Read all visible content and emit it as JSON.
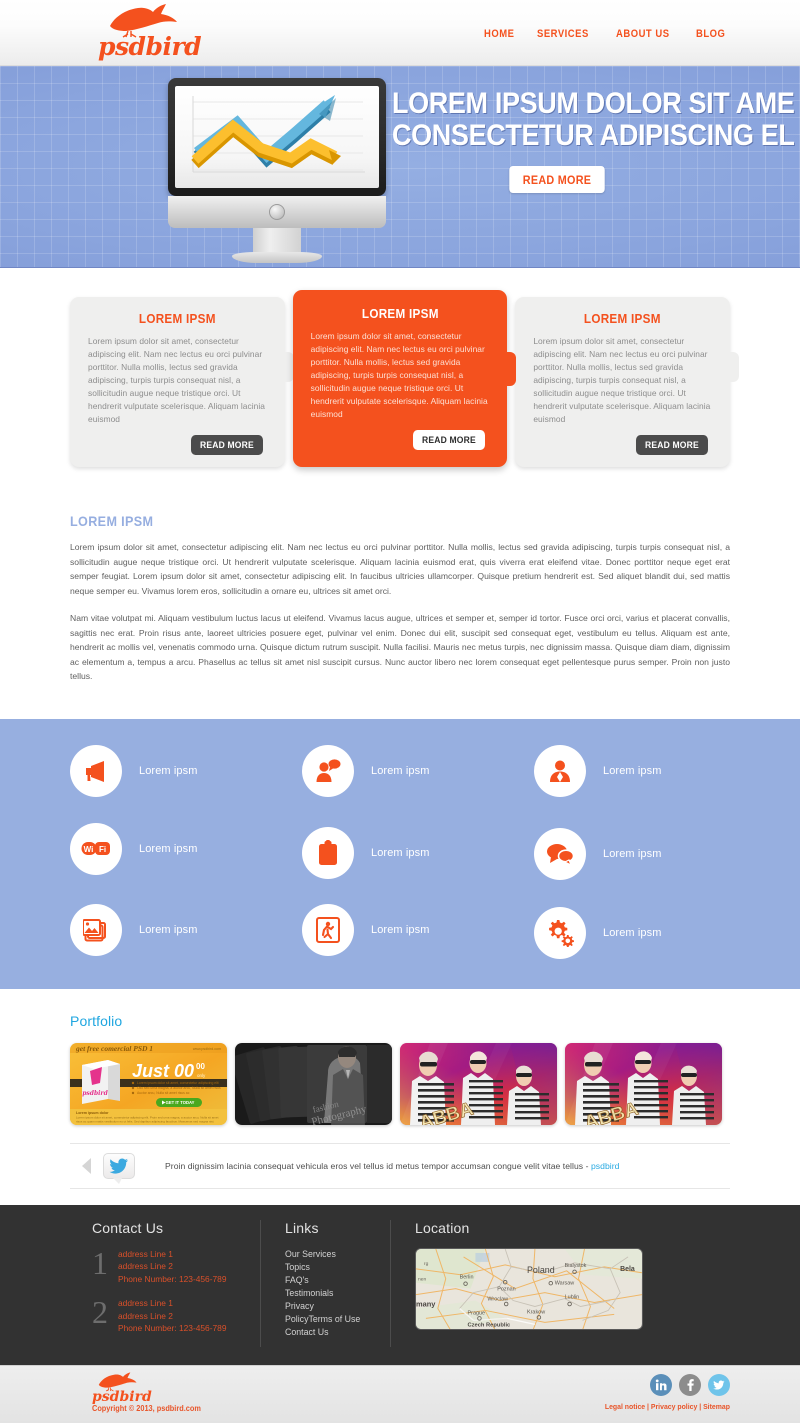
{
  "header": {
    "brand": "psdbird",
    "brand_icon": "bird-logo-icon",
    "nav": [
      {
        "label": "HOME"
      },
      {
        "label": "SERVICES"
      },
      {
        "label": "ABOUT US"
      },
      {
        "label": "BLOG"
      }
    ]
  },
  "hero": {
    "title_line1": "LOREM IPSUM DOLOR SIT AME",
    "title_line2": "CONSECTETUR ADIPISCING EL",
    "button": "READ MORE",
    "illustration": "desktop-monitor-growth-chart"
  },
  "boxes": [
    {
      "title": "LOREM IPSM",
      "body": "Lorem ipsum dolor sit amet, consectetur adipiscing elit. Nam nec lectus eu orci pulvinar porttitor. Nulla mollis, lectus sed gravida adipiscing, turpis turpis consequat nisl, a sollicitudin augue neque tristique orci. Ut hendrerit vulputate scelerisque. Aliquam lacinia euismod",
      "button": "READ MORE",
      "featured": false
    },
    {
      "title": "LOREM IPSM",
      "body": "Lorem ipsum dolor sit amet, consectetur adipiscing elit. Nam nec lectus eu orci pulvinar porttitor. Nulla mollis, lectus sed gravida adipiscing, turpis turpis consequat nisl, a sollicitudin augue neque tristique orci. Ut hendrerit vulputate scelerisque. Aliquam lacinia euismod",
      "button": "READ MORE",
      "featured": true
    },
    {
      "title": "LOREM IPSM",
      "body": "Lorem ipsum dolor sit amet, consectetur adipiscing elit. Nam nec lectus eu orci pulvinar porttitor. Nulla mollis, lectus sed gravida adipiscing, turpis turpis consequat nisl, a sollicitudin augue neque tristique orci. Ut hendrerit vulputate scelerisque. Aliquam lacinia euismod",
      "button": "READ MORE",
      "featured": false
    }
  ],
  "content": {
    "title": "LOREM IPSM",
    "paragraph1": "Lorem ipsum dolor sit amet, consectetur adipiscing elit. Nam nec lectus eu orci pulvinar porttitor. Nulla mollis, lectus sed gravida adipiscing, turpis turpis consequat nisl, a sollicitudin augue neque tristique orci. Ut hendrerit vulputate scelerisque. Aliquam lacinia euismod erat, quis viverra erat eleifend vitae. Donec porttitor neque eget erat semper feugiat. Lorem ipsum dolor sit amet, consectetur adipiscing elit. In faucibus ultricies ullamcorper. Quisque pretium hendrerit est. Sed aliquet blandit dui, sed mattis neque semper eu. Vivamus lorem eros, sollicitudin a ornare eu, ultrices sit amet orci.",
    "paragraph2": "Nam vitae volutpat mi. Aliquam vestibulum luctus lacus ut eleifend. Vivamus lacus augue, ultrices et semper et, semper id tortor. Fusce orci orci, varius et placerat convallis, sagittis nec erat. Proin risus ante, laoreet ultricies posuere eget, pulvinar vel enim. Donec dui elit, suscipit sed consequat eget, vestibulum eu tellus. Aliquam est ante, hendrerit ac mollis vel, venenatis commodo urna. Quisque dictum rutrum suscipit. Nulla facilisi. Mauris nec metus turpis, nec dignissim massa. Quisque diam diam, dignissim ac elementum a, tempus a arcu. Phasellus ac tellus sit amet nisl suscipit cursus. Nunc auctor libero nec lorem consequat eget pellentesque purus semper. Proin non justo tellus."
  },
  "services": [
    {
      "icon": "megaphone-icon",
      "label": "Lorem ipsm"
    },
    {
      "icon": "user-speech-bubble-icon",
      "label": "Lorem ipsm"
    },
    {
      "icon": "user-icon",
      "label": "Lorem ipsm"
    },
    {
      "icon": "wifi-badge-icon",
      "label": "Lorem ipsm"
    },
    {
      "icon": "clipboard-icon",
      "label": "Lorem ipsm"
    },
    {
      "icon": "chat-bubbles-icon",
      "label": "Lorem ipsm"
    },
    {
      "icon": "photos-icon",
      "label": "Lorem ipsm"
    },
    {
      "icon": "running-man-exit-icon",
      "label": "Lorem ipsm"
    },
    {
      "icon": "gears-icon",
      "label": "Lorem ipsm"
    }
  ],
  "portfolio": {
    "title": "Portfolio",
    "items": [
      {
        "name": "psd-product-box-promo",
        "caption": "Just 00",
        "caption_sup": "00",
        "caption_sub": "only",
        "banner": "get free commercial PSD",
        "cta": "GET IT TODAY"
      },
      {
        "name": "fashion-photography-cards",
        "caption": "fashion Photography"
      },
      {
        "name": "party-girl-poster-1",
        "caption": ""
      },
      {
        "name": "party-girl-poster-2",
        "caption": ""
      }
    ]
  },
  "tweet": {
    "prev_icon": "prev-arrow-icon",
    "bird_icon": "twitter-bird-icon",
    "text": "Proin dignissim lacinia consequat vehicula eros vel tellus id metus tempor accumsan congue velit vitae tellus",
    "separator": " - ",
    "handle": "psdbird"
  },
  "footer": {
    "contact": {
      "title": "Contact Us",
      "entries": [
        {
          "num": "1",
          "line1": "address Line 1",
          "line2": "address Line 2",
          "phone": "Phone Number: 123-456-789"
        },
        {
          "num": "2",
          "line1": "address Line 1",
          "line2": "address Line 2",
          "phone": "Phone Number: 123-456-789"
        }
      ]
    },
    "links": {
      "title": "Links",
      "items": [
        "Our Services",
        "Topics",
        "FAQ's",
        "Testimonials",
        "Privacy",
        "PolicyTerms of Use",
        "Contact Us"
      ]
    },
    "location": {
      "title": "Location",
      "map_labels": [
        "Poland",
        "Berlin",
        "Poznan",
        "Wroclaw",
        "Warsaw",
        "Lublin",
        "Krakow",
        "Prague",
        "Czech Republic",
        "Bialystok",
        "Bela",
        "many"
      ]
    }
  },
  "bottom": {
    "brand": "psdbird",
    "copyright": "Copyright © 2013, psdbird.com",
    "socials": [
      {
        "icon": "linkedin-icon",
        "name": "LinkedIn"
      },
      {
        "icon": "facebook-icon",
        "name": "Facebook"
      },
      {
        "icon": "twitter-icon",
        "name": "Twitter"
      }
    ],
    "legal": "Legal notice | Privacy policy | Sitemap"
  },
  "colors": {
    "accent": "#f4511e",
    "hero_blue": "#8aa4dd",
    "services_blue": "#97afe0",
    "footer_dark": "#323232",
    "portfolio_blue": "#1fa6e0"
  }
}
